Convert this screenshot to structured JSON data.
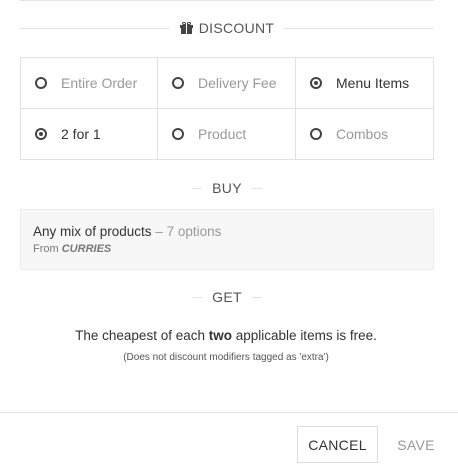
{
  "discount": {
    "header_label": "DISCOUNT",
    "options": [
      {
        "label": "Entire Order",
        "selected": false
      },
      {
        "label": "Delivery Fee",
        "selected": false
      },
      {
        "label": "Menu Items",
        "selected": true
      },
      {
        "label": "2 for 1",
        "selected": true
      },
      {
        "label": "Product",
        "selected": false
      },
      {
        "label": "Combos",
        "selected": false
      }
    ]
  },
  "buy": {
    "header_label": "BUY",
    "products_text": "Any mix of products",
    "options_text": "– 7 options",
    "from_label": "From",
    "from_source": "CURRIES"
  },
  "get": {
    "header_label": "GET",
    "text_before": "The cheapest of each",
    "text_bold": "two",
    "text_after": "applicable items is free.",
    "note": "(Does not discount modifiers tagged as 'extra')"
  },
  "footer": {
    "cancel_label": "CANCEL",
    "save_label": "SAVE"
  }
}
